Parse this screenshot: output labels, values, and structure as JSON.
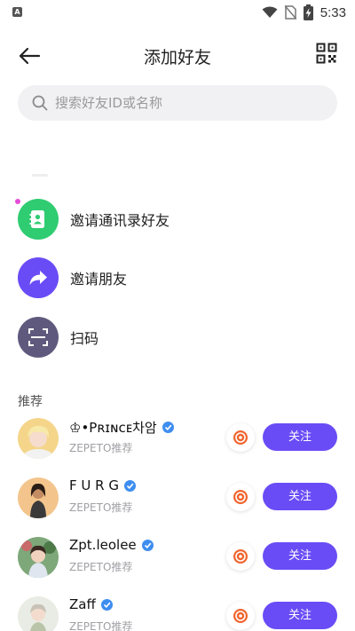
{
  "status_bar": {
    "app_badge": "A",
    "time": "5:33",
    "icons": [
      "wifi-icon",
      "no-sim-icon",
      "battery-charging-icon"
    ]
  },
  "header": {
    "title": "添加好友",
    "back_icon": "arrow-left-icon",
    "qr_icon": "qr-code-icon"
  },
  "search": {
    "placeholder": "搜索好友ID或名称",
    "value": ""
  },
  "actions": [
    {
      "label": "邀请通讯录好友",
      "icon": "contacts-book-icon",
      "color": "#2fcc71"
    },
    {
      "label": "邀请朋友",
      "icon": "share-arrow-icon",
      "color": "#6a4cf6"
    },
    {
      "label": "扫码",
      "icon": "scan-icon",
      "color": "#5f5a7d"
    }
  ],
  "recommend": {
    "title": "推荐",
    "users": [
      {
        "name": "♔•Pʀɪɴᴄᴇ차암",
        "sub": "ZEPETO推荐",
        "follow_label": "关注",
        "verified": true
      },
      {
        "name": "F U R G",
        "sub": "ZEPETO推荐",
        "follow_label": "关注",
        "verified": true
      },
      {
        "name": "Zpt.leolee",
        "sub": "ZEPETO推荐",
        "follow_label": "关注",
        "verified": true
      },
      {
        "name": "Zaff",
        "sub": "ZEPETO推荐",
        "follow_label": "关注",
        "verified": true
      }
    ]
  },
  "colors": {
    "accent": "#6a4cf6",
    "green": "#2fcc71",
    "scan": "#5f5a7d",
    "verified": "#3e8ef0",
    "coin": "#f0642d"
  }
}
